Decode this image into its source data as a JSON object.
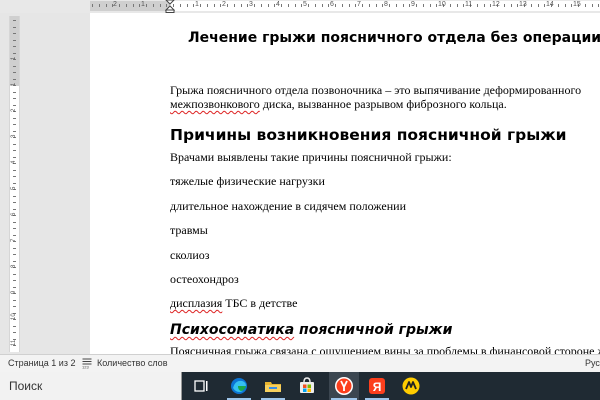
{
  "document": {
    "title": "Лечение грыжи поясничного отдела без операции",
    "intro_line1": "Грыжа поясничного отдела позвоночника – это выпячивание деформированного",
    "intro_line2_misspelled": "межпозвонкового",
    "intro_line2_rest": " диска, вызванное разрывом фиброзного кольца.",
    "heading_causes": "Причины возникновения поясничной грыжи",
    "causes_intro": "Врачами выявлены такие причины поясничной грыжи:",
    "causes": [
      "тяжелые физические нагрузки",
      "длительное нахождение в сидячем положении",
      "травмы",
      "сколиоз",
      "остеохондроз"
    ],
    "cause_last_misspelled": "дисплазия",
    "cause_last_rest": " ТБС в детстве",
    "heading_psycho_misspelled": "Психосоматика",
    "heading_psycho_rest": " поясничной грыжи",
    "psycho_line": "Поясничная грыжа связана с ощущением вины за проблемы в финансовой стороне жизни"
  },
  "statusbar": {
    "page_info": "Страница 1 из 2",
    "word_count": "Количество слов",
    "language_partial": "Рус"
  },
  "taskbar": {
    "search_placeholder": "Поиск",
    "apps": [
      "task-view",
      "edge",
      "file-explorer",
      "store",
      "yandex-browser",
      "yandex",
      "yandex-music"
    ]
  },
  "ruler": {
    "h_numbers_left": [
      "2",
      "1"
    ],
    "h_numbers_right": [
      "1",
      "2",
      "3",
      "4",
      "5",
      "6",
      "7",
      "8",
      "9",
      "10",
      "11",
      "12",
      "13",
      "14",
      "15",
      "16"
    ],
    "v_numbers": [
      "1",
      "1",
      "2",
      "3",
      "4",
      "5",
      "6",
      "7",
      "8",
      "9",
      "10",
      "11",
      "12"
    ]
  },
  "colors": {
    "spell_underline": "#d22222",
    "taskbar_bg": "#1f2a33",
    "yandex_red": "#fc3f1d",
    "edge_blue": "#0c74d4"
  }
}
